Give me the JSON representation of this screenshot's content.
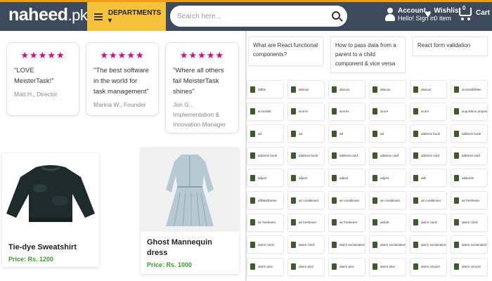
{
  "header": {
    "logo_text": "naheed",
    "logo_suffix": ".pk",
    "departments_label": "DEPARTMENTS ▾",
    "search_placeholder": "Search here...",
    "account_title": "Account",
    "account_sub": "Hello! Sign in",
    "wishlist_title": "Wishlist",
    "wishlist_sub": "0 item",
    "cart_label": "Cart",
    "cart_count": "0"
  },
  "testimonials": [
    {
      "stars": "★★★★★",
      "quote": "\"LOVE MeisterTask!\"",
      "author": "Matt H., Director"
    },
    {
      "stars": "★★★★★",
      "quote": "\"The best software in the world for task management\"",
      "author": "Marina W., Founder"
    },
    {
      "stars": "★★★★★",
      "quote": "\"Where all others fail MeisterTask shines\"",
      "author": "Jon G., Implementation & Innovation Manager"
    }
  ],
  "products": [
    {
      "name": "Tie-dye Sweatshirt",
      "price": "Price: Rs. 1200"
    },
    {
      "name": "Ghost Mannequin dress",
      "price": "Price: Rs. 1000"
    }
  ],
  "questions": [
    "What are React functional components?",
    "How to pass data from a parent to a child component & vice versa",
    "React form validation"
  ],
  "icon_tiles": [
    [
      "3dbtn",
      "abacus",
      "abacus",
      "abacus",
      "abacus",
      "accessibilities"
    ],
    [
      "accessibl",
      "acorns",
      "acorns",
      "acorn",
      "acorn",
      "acquisition proposal"
    ],
    [
      "ad",
      "ad",
      "ad",
      "ad",
      "address book",
      "address book"
    ],
    [
      "address book",
      "address book",
      "address card",
      "address card",
      "address card",
      "address card"
    ],
    [
      "adjust",
      "adjust",
      "adjust",
      "adjust",
      "adn",
      "adwords"
    ],
    [
      "affiliatetheme",
      "air conditioner",
      "air conditioner",
      "air conditioner",
      "air conditioner",
      "air freshener"
    ],
    [
      "air freshener",
      "air freshener",
      "air freshener",
      "airbnb",
      "alarm clock",
      "alarm clock"
    ],
    [
      "alarm clock",
      "alarm clock",
      "alarm exclamation",
      "alarm exclamation",
      "alarm exclamation",
      "alarm exclamation"
    ],
    [
      "alarm plus",
      "alarm plus",
      "alarm plus",
      "alarm plus",
      "alarm snooze",
      "alarm snooze"
    ]
  ],
  "colors": {
    "header_bg": "#3d4a5c",
    "accent_top": "#f39c12",
    "departments_bg": "#f5c33b",
    "stars": "#e6007e",
    "price": "#3a9b2e",
    "icon_green": "#3d5a2a"
  }
}
